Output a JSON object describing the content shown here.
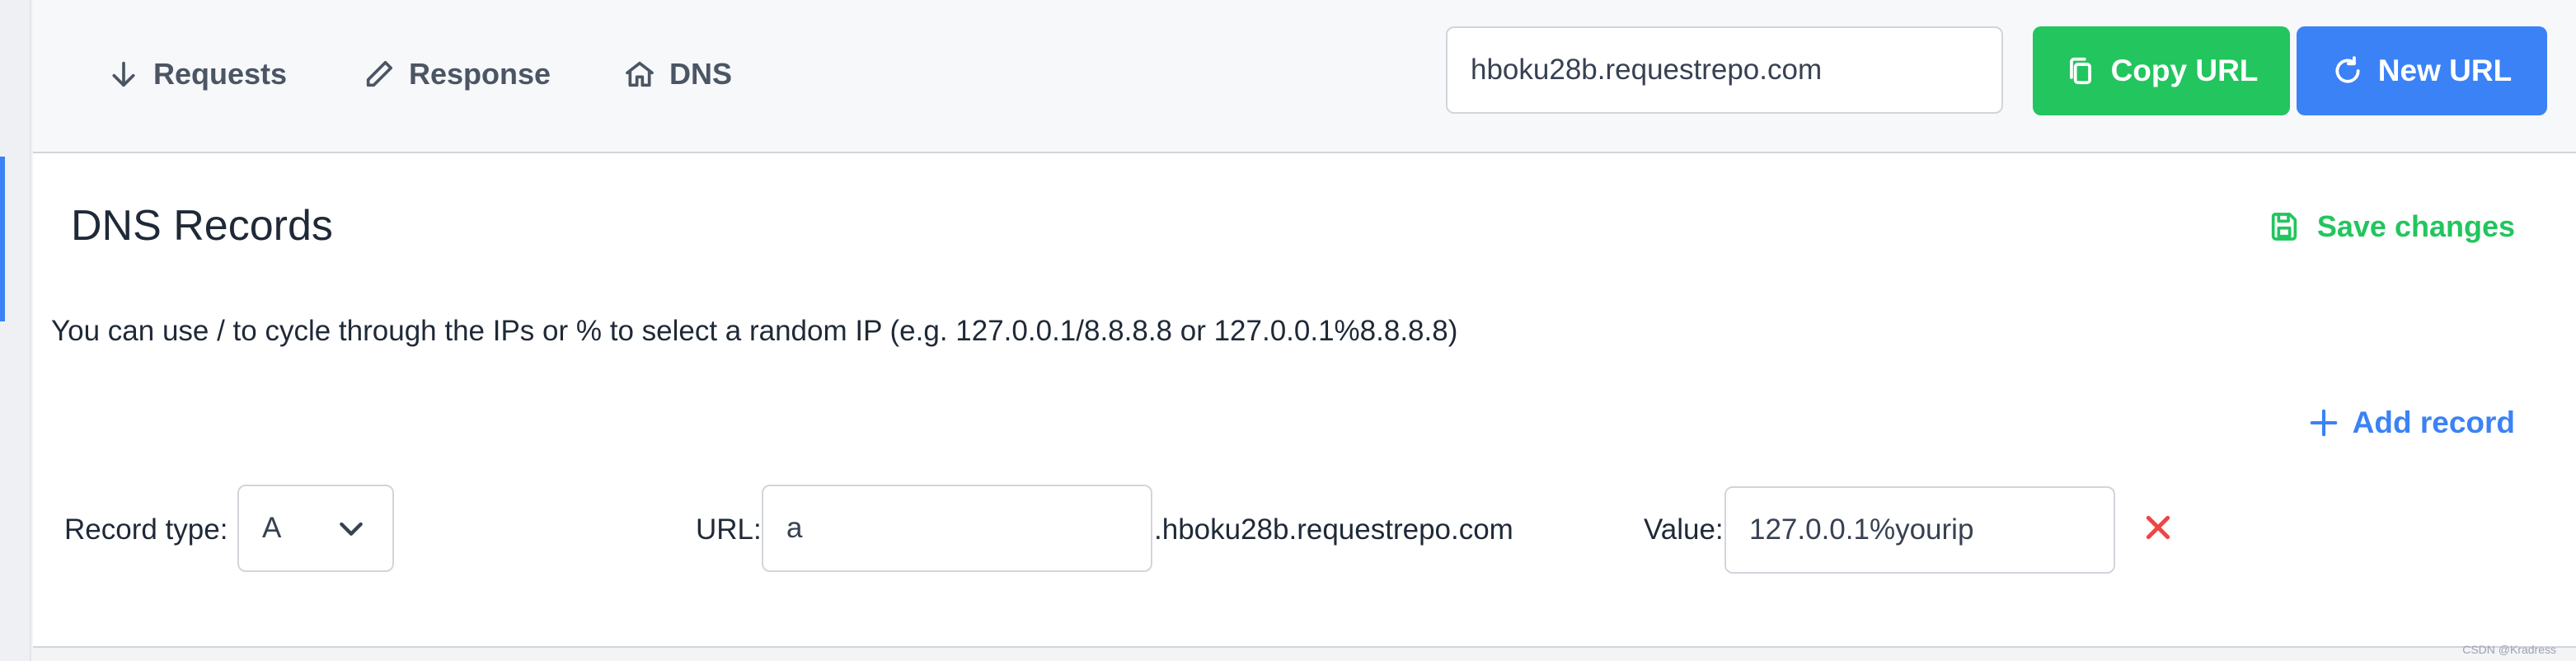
{
  "nav": {
    "items": [
      {
        "label": "Requests",
        "icon": "arrow-down-icon"
      },
      {
        "label": "Response",
        "icon": "pencil-icon"
      },
      {
        "label": "DNS",
        "icon": "home-icon"
      }
    ]
  },
  "header": {
    "url_value": "hboku28b.requestrepo.com",
    "copy_label": "Copy URL",
    "new_label": "New URL"
  },
  "dns": {
    "title": "DNS Records",
    "save_label": "Save changes",
    "help_text": "You can use / to cycle through the IPs or % to select a random IP (e.g. 127.0.0.1/8.8.8.8 or 127.0.0.1%8.8.8.8)",
    "add_label": "Add record",
    "record": {
      "type_label": "Record type:",
      "type_value": "A",
      "url_label": "URL:",
      "url_value": "a",
      "suffix": ".hboku28b.requestrepo.com",
      "value_label": "Value:",
      "value_value": "127.0.0.1%yourip"
    }
  },
  "watermark": "CSDN @Kradress",
  "colors": {
    "green": "#22c55e",
    "blue": "#3b82f6",
    "red": "#ef4444"
  }
}
